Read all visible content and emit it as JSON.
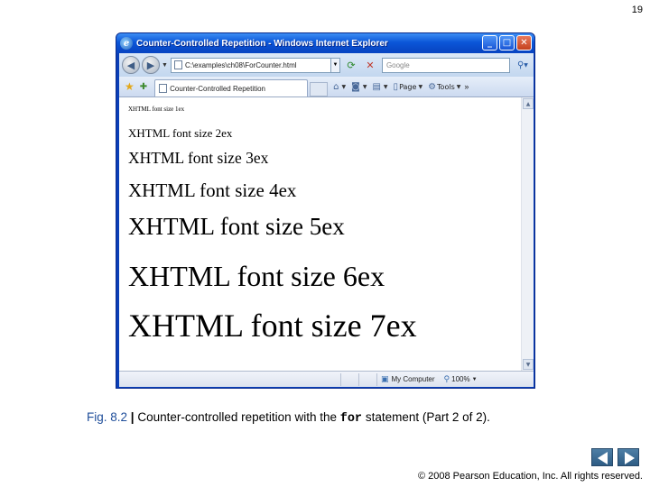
{
  "slide": {
    "number": "19",
    "caption": {
      "fig_label": "Fig. 8.2",
      "separator": "|",
      "text_before": "Counter-controlled repetition with the",
      "code": "for",
      "text_after": "statement (Part 2 of 2)."
    },
    "copyright": "© 2008 Pearson Education, Inc.  All rights reserved."
  },
  "browser": {
    "title": "Counter-Controlled Repetition - Windows Internet Explorer",
    "address": "C:\\examples\\ch08\\ForCounter.html",
    "search_placeholder": "Google",
    "tab_label": "Counter-Controlled Repetition",
    "commands": [
      {
        "label": "",
        "icon": "home-icon"
      },
      {
        "label": "",
        "icon": "feeds-icon"
      },
      {
        "label": "",
        "icon": "print-icon"
      },
      {
        "label": "Page",
        "icon": "page-icon"
      },
      {
        "label": "Tools",
        "icon": "tools-icon"
      }
    ],
    "status": {
      "zone": "My Computer",
      "zoom": "100%"
    },
    "content_lines": [
      {
        "text": "XHTML font size 1ex",
        "size": "1ex"
      },
      {
        "text": "XHTML font size 2ex",
        "size": "2ex"
      },
      {
        "text": "XHTML font size 3ex",
        "size": "3ex"
      },
      {
        "text": "XHTML font size 4ex",
        "size": "4ex"
      },
      {
        "text": "XHTML font size 5ex",
        "size": "5ex"
      },
      {
        "text": "XHTML font size 6ex",
        "size": "6ex"
      },
      {
        "text": "XHTML font size 7ex",
        "size": "7ex"
      }
    ]
  },
  "colors": {
    "caption_fig": "#1f4e9a",
    "titlebar": "#0b56d8"
  }
}
